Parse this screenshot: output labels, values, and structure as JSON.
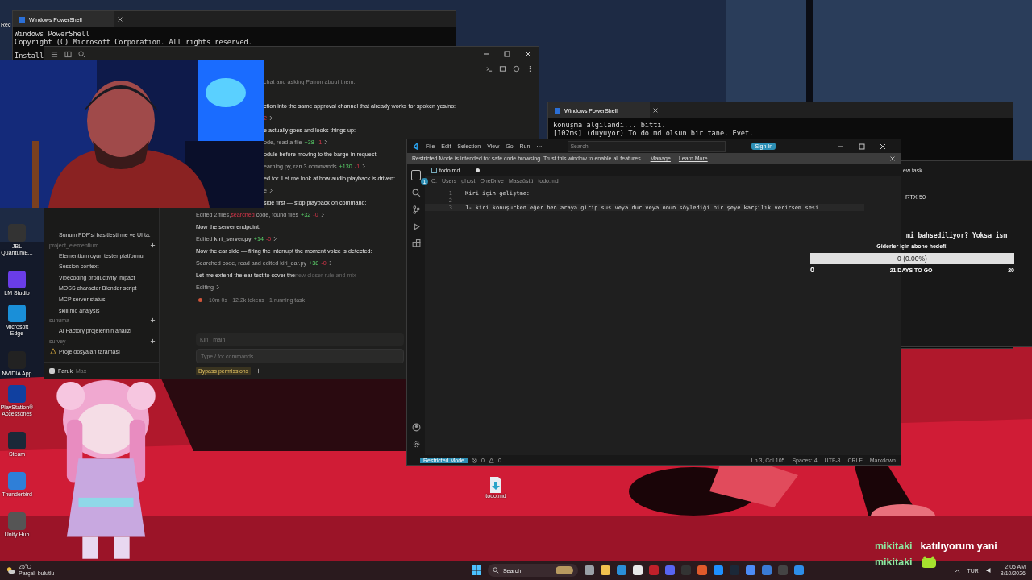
{
  "desktop_icons": [
    {
      "label": "Rec"
    },
    {
      "label": "JBL QuantumE..."
    },
    {
      "label": "LM Studio"
    },
    {
      "label": "Microsoft Edge"
    },
    {
      "label": "NVIDIA App"
    },
    {
      "label": "PlayStation® Accessories"
    },
    {
      "label": "Steam"
    },
    {
      "label": "Thunderbird"
    },
    {
      "label": "Unity Hub"
    }
  ],
  "desktop_file": {
    "label": "todo.md"
  },
  "powershell_back": {
    "title": "Windows PowerShell",
    "lines": [
      "Windows PowerShell",
      "Copyright (C) Microsoft Corporation. All rights reserved.",
      "Install"
    ]
  },
  "assistant_app": {
    "sidebar": {
      "items_top": [
        {
          "label": "Sunum PDF'si basitleştirme ve UI ta:"
        }
      ],
      "groups": [
        {
          "name": "project_elementium",
          "items": [
            {
              "label": "Elementium oyun tester platformu",
              "kind": "chat"
            },
            {
              "label": "Session context",
              "kind": "chat"
            },
            {
              "label": "Vibecoding productivity impact",
              "kind": "chat"
            },
            {
              "label": "MOSS character Blender script",
              "kind": "chat"
            },
            {
              "label": "MCP server status",
              "kind": "chat"
            },
            {
              "label": "skill.md analysis",
              "kind": "chat"
            }
          ]
        },
        {
          "name": "sunuma",
          "items": [
            {
              "label": "AI Factory projelerinin analizi",
              "kind": "chat"
            }
          ]
        },
        {
          "name": "survey",
          "items": [
            {
              "label": "Proje dosyaları taraması",
              "kind": "warning"
            }
          ]
        }
      ],
      "user": "Faruk",
      "plan": "Max"
    },
    "messages": [
      {
        "kind": "cut",
        "text": "chat and asking Patron about them:"
      },
      {
        "kind": "cut",
        "text": "ction into the same approval channel that already works for spoken yes/no:"
      },
      {
        "kind": "tool_cut",
        "removed": "2"
      },
      {
        "kind": "cut",
        "text": "e actually goes and looks things up:"
      },
      {
        "kind": "tool_cut",
        "text": "ode, read a file",
        "added": "+38",
        "removed": "-1"
      },
      {
        "kind": "cut",
        "text": "odule before moving to the barge-in request:"
      },
      {
        "kind": "tool_cut",
        "text": "earning.py, ran 3 commands",
        "added": "+130",
        "removed": "-1"
      },
      {
        "kind": "cut",
        "text": "ed for. Let me look at how audio playback is driven:"
      },
      {
        "kind": "tool_cut",
        "text": "e"
      },
      {
        "kind": "cut",
        "text": "side first — stop playback on command:"
      },
      {
        "kind": "tool",
        "text": "Edited 2 files,",
        "highlight": "searched",
        "text_after": "code, found files",
        "added": "+32",
        "removed": "-0"
      },
      {
        "kind": "text",
        "text": "Now the server endpoint:"
      },
      {
        "kind": "tool",
        "text": "Edited **kiri_server.py**",
        "added": "+14",
        "removed": "-0"
      },
      {
        "kind": "text",
        "text": "Now the ear side — firing the interrupt the moment voice is detected:"
      },
      {
        "kind": "tool",
        "text": "Searched code, read and edited kiri_ear.py",
        "added": "+38",
        "removed": "-0"
      },
      {
        "kind": "text",
        "text": "Let me extend the ear test to cover the",
        "faded": "new closer rule and mix"
      },
      {
        "kind": "tool",
        "text": "Editing"
      }
    ],
    "status": "10m 0s · 12.2k tokens · 1 running task",
    "composer": {
      "project": "Kiri",
      "branch": "main",
      "placeholder": "Type / for commands",
      "mode": "Bypass permissions"
    }
  },
  "powershell_front": {
    "title": "Windows PowerShell",
    "lines": [
      "konuşma algılandı... bitti.",
      "[102ms] (duyuyor) To do.md olsun bir tane. Evet."
    ]
  },
  "background_window": {
    "texts": [
      "ew task",
      "RTX 50",
      "mi bahsediliyor? Yoksa ism"
    ]
  },
  "editor": {
    "menu": [
      "File",
      "Edit",
      "Selection",
      "View",
      "Go",
      "Run",
      "···"
    ],
    "search_placeholder": "Search",
    "sign_in": "Sign In",
    "banner": {
      "text": "Restricted Mode is intended for safe code browsing. Trust this window to enable all features.",
      "links": [
        "Manage",
        "Learn More"
      ]
    },
    "tab": {
      "label": "todo.md",
      "modified": true
    },
    "breadcrumb": [
      "C:",
      "Users",
      "ghost",
      "OneDrive",
      "Masaüstü",
      "todo.md"
    ],
    "badge": "1",
    "lines": [
      {
        "number": "1",
        "text": "Kiri için geliştme:"
      },
      {
        "number": "2"
      },
      {
        "number": "3",
        "text": "1- kiri konuşurken eğer ben araya girip sus veya dur veya onun söylediği bir şeye karşılık verirsem sesi"
      }
    ],
    "status_left": {
      "mode": "Restricted Mode",
      "errors": "0",
      "warnings": "0"
    },
    "status_right": [
      "Ln 3, Col 105",
      "Spaces: 4",
      "UTF-8",
      "CRLF",
      "Markdown"
    ]
  },
  "goal": {
    "title": "Giderler için abone hedefi!",
    "reading": "0 (0.00%)",
    "level": 0,
    "start": "0",
    "countdown": "21 DAYS TO GO",
    "end": "20"
  },
  "chat_overlay": [
    {
      "user": "mikitaki",
      "message": "katılıyorum yani",
      "kind": "text"
    },
    {
      "user": "mikitaki",
      "kind": "emote"
    }
  ],
  "taskbar": {
    "weather": {
      "temp": "25°C",
      "text": "Parçalı bulutlu"
    },
    "search": "Search",
    "language": "TUR",
    "time": "2:05 AM",
    "date": "8/10/2026"
  }
}
